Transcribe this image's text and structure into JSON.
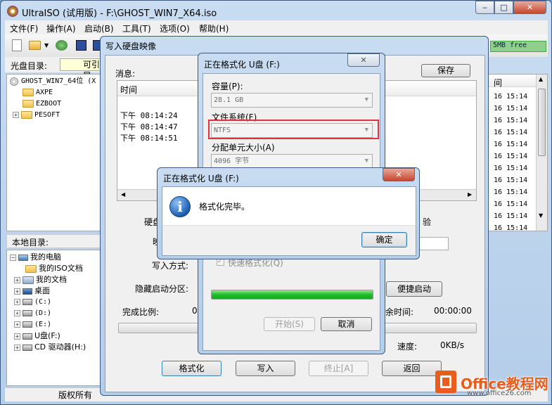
{
  "main": {
    "title": "UltraISO (试用版) - F:\\GHOST_WIN7_X64.iso",
    "menu": [
      "文件(F)",
      "操作(A)",
      "启动(B)",
      "工具(T)",
      "选项(O)",
      "帮助(H)"
    ],
    "free": "5MB free",
    "disc_dir_label": "光盘目录:",
    "bootable": "可引导",
    "tree": {
      "root": "GHOST_WIN7_64位 (X",
      "items": [
        "AXPE",
        "EZBOOT",
        "PESOFT"
      ]
    },
    "local_dir_label": "本地目录:",
    "local_tree": [
      "我的电脑",
      "我的ISO文档",
      "我的文档",
      "桌面",
      "(C:)",
      "(D:)",
      "(E:)",
      "U盘(F:)",
      "CD 驱动器(H:)"
    ],
    "times": [
      "16 15:14",
      "16 15:14",
      "16 15:14",
      "16 15:14",
      "16 15:14",
      "16 15:14",
      "16 15:14",
      "16 15:14",
      "16 15:14",
      "16 15:14",
      "16 15:14",
      "16 15:14"
    ],
    "col_header": "间",
    "copyright": "版权所有"
  },
  "write": {
    "title": "写入硬盘映像",
    "msg_label": "消息:",
    "save": "保存",
    "col_time": "时间",
    "log": [
      "下午 08:14:24",
      "下午 08:14:47",
      "下午 08:14:51"
    ],
    "disk_label": "硬盘",
    "verify": "验",
    "image_label": "映",
    "write_mode": "写入方式:",
    "hidden_part": "隐藏启动分区:",
    "quick_boot": "便捷启动",
    "done_ratio": "完成比例:",
    "ratio_val": "0%",
    "remain_label": "余时间:",
    "remain_val": "00:00:00",
    "speed_label": "速度:",
    "speed_val": "0KB/s",
    "buttons": {
      "format": "格式化",
      "write": "写入",
      "stop": "终止[A]",
      "back": "返回"
    }
  },
  "format": {
    "title": "正在格式化 U盘 (F:)",
    "capacity_label": "容量(P):",
    "capacity": "28.1 GB",
    "fs_label": "文件系统(F)",
    "fs": "NTFS",
    "alloc_label": "分配单元大小(A)",
    "alloc": "4096 字节",
    "quick_format": "快速格式化(Q)",
    "progress": 1.0,
    "start": "开始(S)",
    "cancel": "取消"
  },
  "msgbox": {
    "title": "正在格式化 U盘 (F:)",
    "text": "格式化完毕。",
    "ok": "确定"
  },
  "watermark": {
    "text": "Office教程网",
    "url": "www.office26.com"
  }
}
